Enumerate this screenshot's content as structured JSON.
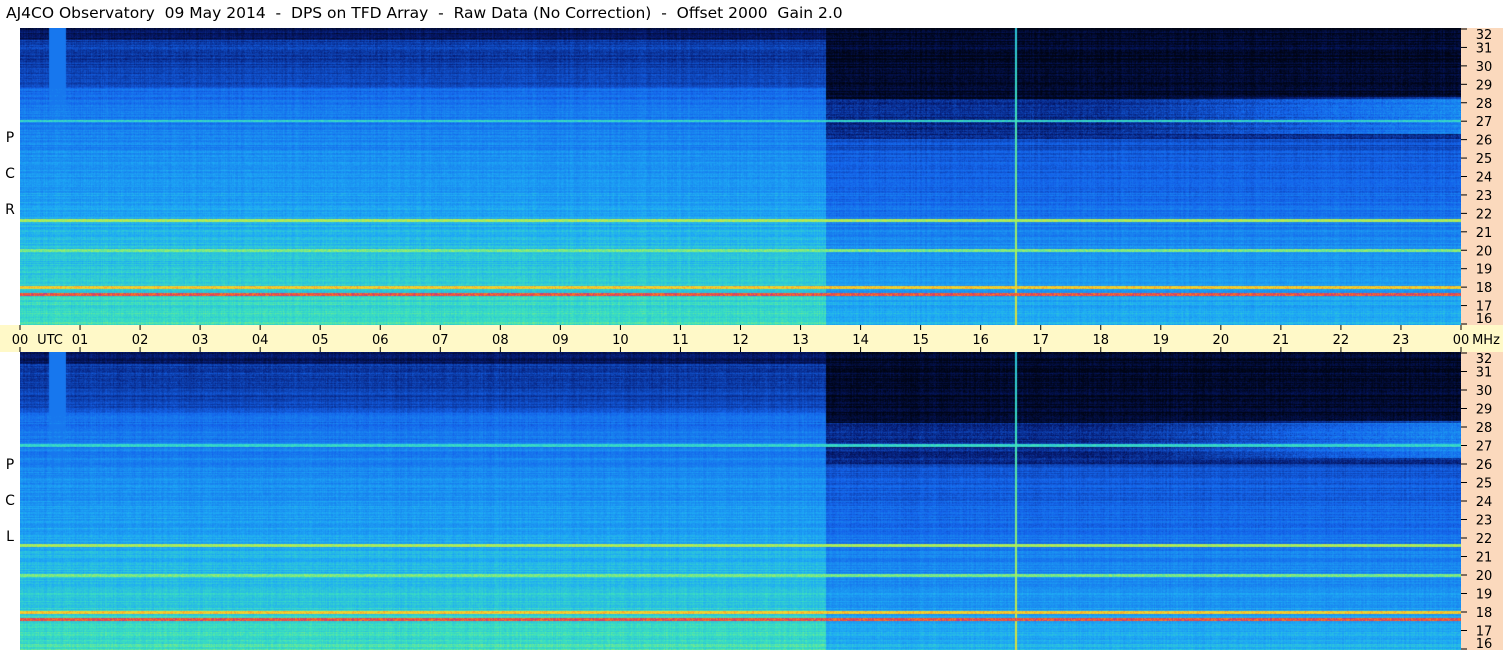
{
  "title": "AJ4CO Observatory  09 May 2014  -  DPS on TFD Array  -  Raw Data (No Correction)  -  Offset 2000  Gain 2.0",
  "panels": [
    {
      "label": "RCP",
      "letters": [
        "P",
        "C",
        "R"
      ]
    },
    {
      "label": "LCP",
      "letters": [
        "P",
        "C",
        "L"
      ]
    }
  ],
  "time_axis": {
    "ticks": [
      "00",
      "01",
      "02",
      "03",
      "04",
      "05",
      "06",
      "07",
      "08",
      "09",
      "10",
      "11",
      "12",
      "13",
      "14",
      "15",
      "16",
      "17",
      "18",
      "19",
      "20",
      "21",
      "22",
      "23",
      "00"
    ],
    "unit_left": "UTC",
    "unit_right": "MHz"
  },
  "freq_axis": {
    "ticks": [
      "16",
      "17",
      "18",
      "19",
      "20",
      "21",
      "22",
      "23",
      "24",
      "25",
      "26",
      "27",
      "28",
      "29",
      "30",
      "31",
      "32"
    ],
    "min": 16,
    "max": 32
  },
  "colors": {
    "axis_freq_bg": "#fbd9bd",
    "axis_time_bg": "#fff9c8",
    "spectrogram_low": "#000814",
    "spectrogram_mid": "#1a78f0",
    "spectrogram_high": "#3cf0a0",
    "spectrogram_peak": "#ff4020"
  },
  "chart_data": [
    {
      "type": "heatmap",
      "panel": "RCP",
      "x_label": "UTC",
      "y_label": "MHz",
      "x_range": [
        0,
        24
      ],
      "y_range": [
        16,
        32
      ],
      "features": [
        {
          "kind": "band",
          "freq_mhz": 17.6,
          "intensity": 0.95
        },
        {
          "kind": "band",
          "freq_mhz": 18.0,
          "intensity": 0.85
        },
        {
          "kind": "band",
          "freq_mhz": 20.0,
          "intensity": 0.7
        },
        {
          "kind": "band",
          "freq_mhz": 21.6,
          "intensity": 0.75
        },
        {
          "kind": "band",
          "freq_mhz": 27.0,
          "intensity": 0.6
        },
        {
          "kind": "vertical_line",
          "time_utc": 16.58,
          "intensity": 0.9
        },
        {
          "kind": "day_night_transition",
          "time_utc": 13.42
        }
      ]
    },
    {
      "type": "heatmap",
      "panel": "LCP",
      "x_label": "UTC",
      "y_label": "MHz",
      "x_range": [
        0,
        24
      ],
      "y_range": [
        16,
        32
      ],
      "features": [
        {
          "kind": "band",
          "freq_mhz": 17.6,
          "intensity": 0.95
        },
        {
          "kind": "band",
          "freq_mhz": 18.0,
          "intensity": 0.85
        },
        {
          "kind": "band",
          "freq_mhz": 20.0,
          "intensity": 0.7
        },
        {
          "kind": "band",
          "freq_mhz": 21.6,
          "intensity": 0.75
        },
        {
          "kind": "band",
          "freq_mhz": 27.0,
          "intensity": 0.6
        },
        {
          "kind": "vertical_line",
          "time_utc": 16.58,
          "intensity": 0.9
        },
        {
          "kind": "day_night_transition",
          "time_utc": 13.42
        }
      ]
    }
  ]
}
